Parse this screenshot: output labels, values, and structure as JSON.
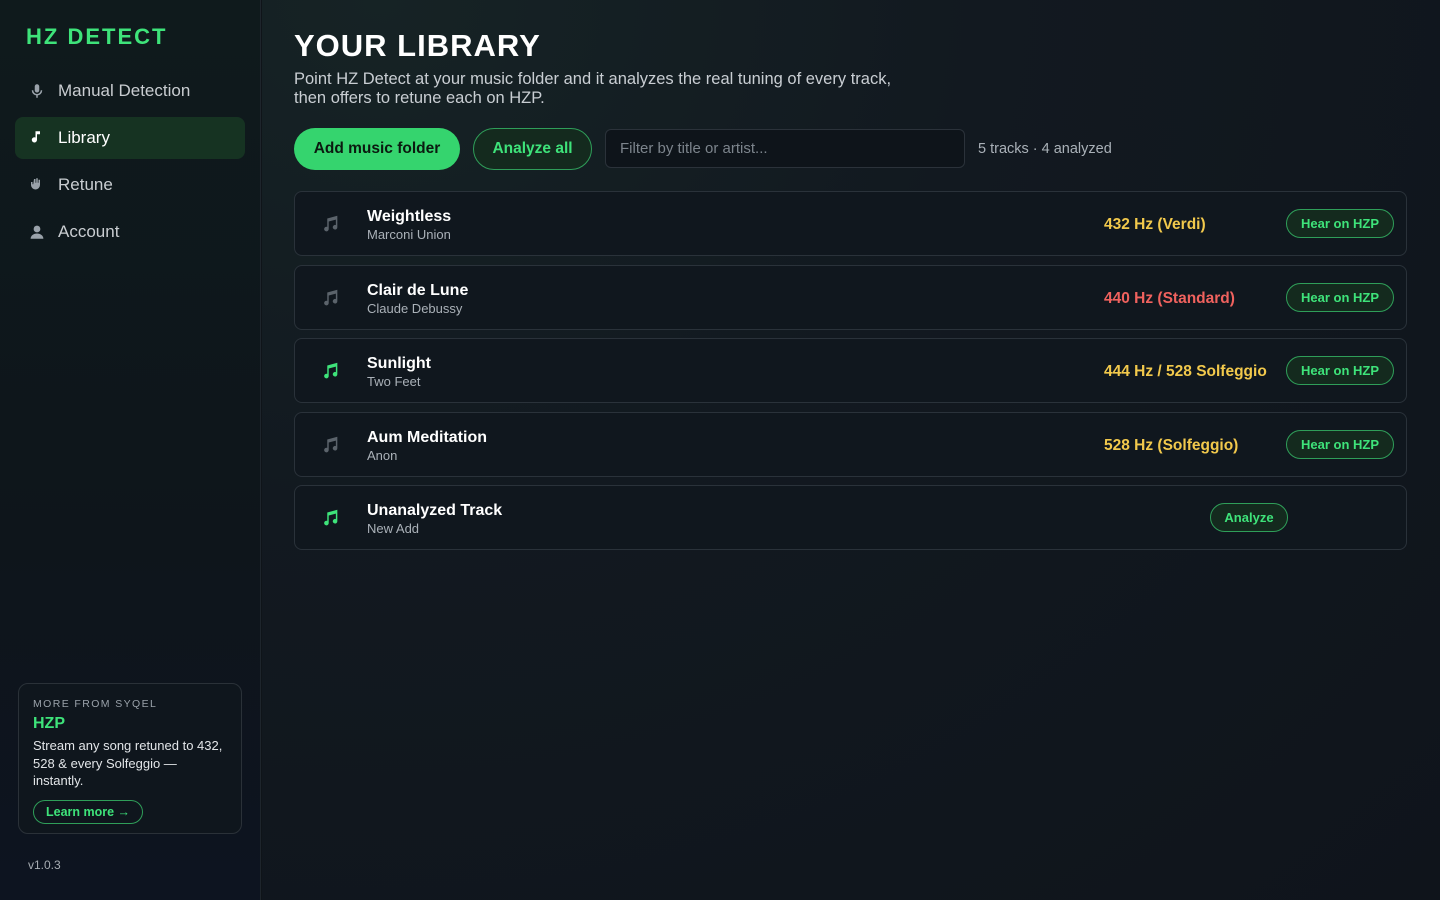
{
  "app": {
    "brand": "HZ DETECT",
    "version": "v1.0.3"
  },
  "sidebar": {
    "items": [
      {
        "label": "Manual Detection",
        "icon": "microphone-icon",
        "active": false
      },
      {
        "label": "Library",
        "icon": "music-note-icon",
        "active": true
      },
      {
        "label": "Retune",
        "icon": "retune-icon",
        "active": false
      },
      {
        "label": "Account",
        "icon": "user-icon",
        "active": false
      }
    ]
  },
  "promo": {
    "kicker": "MORE FROM SYQEL",
    "title": "HZP",
    "text": "Stream any song retuned to 432, 528 & every Solfeggio — instantly.",
    "button": "Learn more →"
  },
  "main": {
    "title": "YOUR LIBRARY",
    "subtitle_line1": "Point HZ Detect at your music folder and it analyzes the real tuning of every track,",
    "subtitle_line2": "then offers to retune each on HZP.",
    "add_folder_label": "Add music folder",
    "analyze_all_label": "Analyze all",
    "filter_placeholder": "Filter by title or artist...",
    "count_text": "5 tracks · 4 analyzed"
  },
  "tracks": [
    {
      "title": "Weightless",
      "artist": "Marconi Union",
      "hz": "432 Hz (Verdi)",
      "hz_color": "#f2c94c",
      "action": "Hear on HZP",
      "icon_active": false
    },
    {
      "title": "Clair de Lune",
      "artist": "Claude Debussy",
      "hz": "440 Hz (Standard)",
      "hz_color": "#f0625e",
      "action": "Hear on HZP",
      "icon_active": false
    },
    {
      "title": "Sunlight",
      "artist": "Two Feet",
      "hz": "444 Hz / 528 Solfeggio",
      "hz_color": "#f2c94c",
      "action": "Hear on HZP",
      "icon_active": true
    },
    {
      "title": "Aum Meditation",
      "artist": "Anon",
      "hz": "528 Hz (Solfeggio)",
      "hz_color": "#f2c94c",
      "action": "Hear on HZP",
      "icon_active": false
    },
    {
      "title": "Unanalyzed Track",
      "artist": "New Add",
      "hz": "",
      "hz_color": "",
      "action": "Analyze",
      "icon_active": true
    }
  ],
  "colors": {
    "accent": "#3ee37a",
    "accent_button": "#35d46e",
    "hz_warm": "#f2c94c",
    "hz_standard": "#f0625e",
    "icon_muted": "#5b636b"
  }
}
